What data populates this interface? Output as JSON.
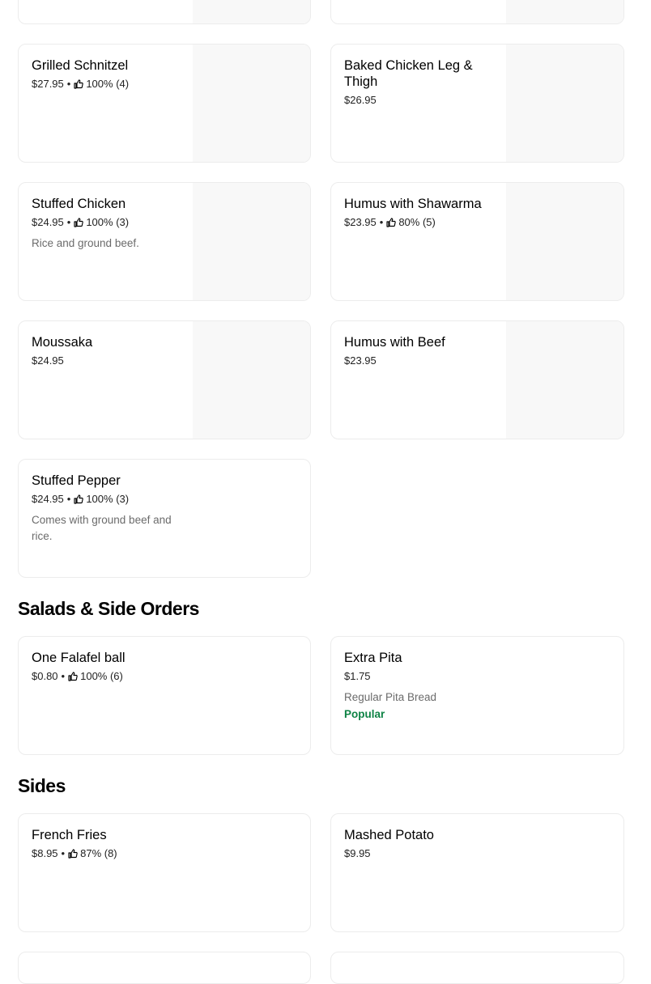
{
  "rows": [
    {
      "left": {
        "name": "",
        "price": "",
        "rating": "",
        "description": "",
        "badge": ""
      },
      "right": {
        "name": "",
        "price": "",
        "rating": "",
        "description": "",
        "badge": ""
      }
    },
    {
      "left": {
        "name": "Grilled Schnitzel",
        "price": "$27.95",
        "rating": "100% (4)"
      },
      "right": {
        "name": "Baked Chicken Leg & Thigh",
        "price": "$26.95"
      }
    },
    {
      "left": {
        "name": "Stuffed Chicken",
        "price": "$24.95",
        "rating": "100% (3)",
        "description": "Rice and ground beef."
      },
      "right": {
        "name": "Humus with Shawarma",
        "price": "$23.95",
        "rating": "80% (5)"
      }
    },
    {
      "left": {
        "name": "Moussaka",
        "price": "$24.95"
      },
      "right": {
        "name": "Humus with Beef",
        "price": "$23.95"
      }
    },
    {
      "left": {
        "name": "Stuffed Pepper",
        "price": "$24.95",
        "rating": "100% (3)",
        "description": "Comes with ground beef and rice."
      }
    }
  ],
  "sections": {
    "salads": {
      "title": "Salads & Side Orders",
      "items": [
        {
          "name": "One Falafel ball",
          "price": "$0.80",
          "rating": "100% (6)"
        },
        {
          "name": "Extra Pita",
          "price": "$1.75",
          "description": "Regular Pita Bread",
          "badge": "Popular"
        }
      ]
    },
    "sides": {
      "title": "Sides",
      "items": [
        {
          "name": "French Fries",
          "price": "$8.95",
          "rating": "87% (8)"
        },
        {
          "name": "Mashed Potato",
          "price": "$9.95"
        }
      ]
    }
  },
  "icons": {
    "rating": "thumbs-up-icon",
    "separator": "•"
  },
  "colors": {
    "popular_badge": "#0e8345",
    "image_placeholder": "#f8f8f8"
  }
}
